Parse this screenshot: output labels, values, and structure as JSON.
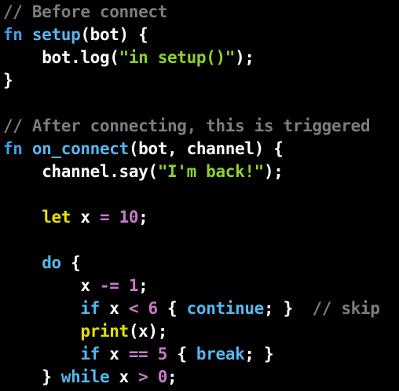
{
  "code": {
    "comment1": "// Before connect",
    "l2_fn": "fn",
    "l2_name": "setup",
    "l2_rest": "(bot) {",
    "l3_indent": "    ",
    "l3_call": "bot.log(",
    "l3_str": "\"in setup()\"",
    "l3_end": ");",
    "l4": "}",
    "comment2": "// After connecting, this is triggered",
    "l7_fn": "fn",
    "l7_name": "on_connect",
    "l7_rest": "(bot, channel) {",
    "l8_indent": "    ",
    "l8_call": "channel.say(",
    "l8_str": "\"I'm back!\"",
    "l8_end": ");",
    "l10_indent": "    ",
    "l10_let": "let",
    "l10_var": " x ",
    "l10_op": "=",
    "l10_sp": " ",
    "l10_num": "10",
    "l10_end": ";",
    "l12_indent": "    ",
    "l12_do": "do",
    "l12_rest": " {",
    "l13_indent": "        ",
    "l13_var": "x ",
    "l13_op": "-=",
    "l13_sp": " ",
    "l13_num": "1",
    "l13_end": ";",
    "l14_indent": "        ",
    "l14_if": "if",
    "l14_var": " x ",
    "l14_op": "<",
    "l14_sp": " ",
    "l14_num": "6",
    "l14_open": " { ",
    "l14_kw": "continue",
    "l14_close": "; }  ",
    "l14_comment": "// skip",
    "l15_indent": "        ",
    "l15_print": "print",
    "l15_rest": "(x);",
    "l16_indent": "        ",
    "l16_if": "if",
    "l16_var": " x ",
    "l16_op": "==",
    "l16_sp": " ",
    "l16_num": "5",
    "l16_open": " { ",
    "l16_kw": "break",
    "l16_close": "; }",
    "l17_indent": "    ",
    "l17_close": "} ",
    "l17_while": "while",
    "l17_var": " x ",
    "l17_op": ">",
    "l17_sp": " ",
    "l17_num": "0",
    "l17_end": ";"
  },
  "colors": {
    "background": "#000000",
    "comment": "#7d7d7d",
    "keyword": "#3ba0e6",
    "function": "#5ab4ee",
    "string": "#8ed12e",
    "number": "#c879c8",
    "let": "#e4e000",
    "plain": "#ffffff"
  }
}
